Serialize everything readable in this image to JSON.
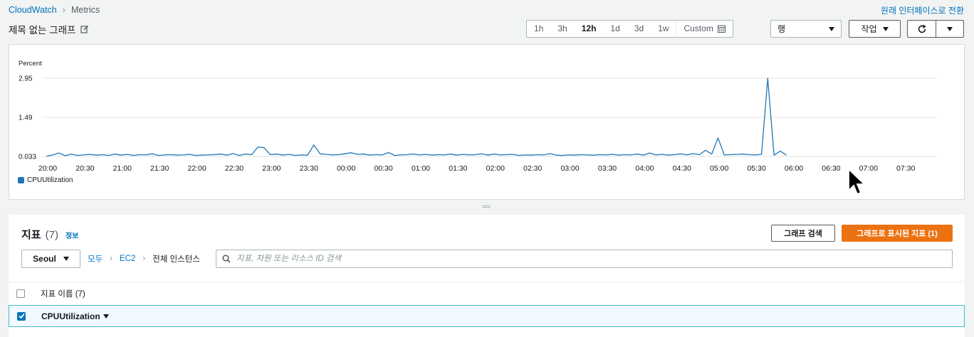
{
  "breadcrumb": {
    "root": "CloudWatch",
    "current": "Metrics"
  },
  "switch_link": "원래 인터페이스로 전환",
  "graph_title": "제목 없는 그래프",
  "time_ranges": [
    "1h",
    "3h",
    "12h",
    "1d",
    "3d",
    "1w"
  ],
  "time_range_selected": "12h",
  "custom_label": "Custom",
  "view_select": {
    "value": "행"
  },
  "actions_label": "작업",
  "chart_data": {
    "type": "line",
    "ylabel": "Percent",
    "y_ticks": [
      "0.033",
      "1.49",
      "2.95"
    ],
    "ylim": [
      0.033,
      2.95
    ],
    "x_ticks": [
      "20:00",
      "20:30",
      "21:00",
      "21:30",
      "22:00",
      "22:30",
      "23:00",
      "23:30",
      "00:00",
      "00:30",
      "01:00",
      "01:30",
      "02:00",
      "02:30",
      "03:00",
      "03:30",
      "04:00",
      "04:30",
      "05:00",
      "05:30",
      "06:00",
      "06:30",
      "07:00",
      "07:30"
    ],
    "x_start": "19:59",
    "x_step_minutes": 5,
    "series": [
      {
        "name": "CPUUtilization",
        "color": "#1f77b4",
        "values": [
          0.04,
          0.09,
          0.16,
          0.06,
          0.12,
          0.07,
          0.09,
          0.11,
          0.08,
          0.1,
          0.07,
          0.12,
          0.08,
          0.11,
          0.07,
          0.1,
          0.09,
          0.13,
          0.07,
          0.09,
          0.1,
          0.08,
          0.09,
          0.11,
          0.07,
          0.08,
          0.09,
          0.1,
          0.12,
          0.08,
          0.14,
          0.07,
          0.12,
          0.1,
          0.38,
          0.36,
          0.1,
          0.12,
          0.08,
          0.11,
          0.07,
          0.09,
          0.08,
          0.46,
          0.13,
          0.11,
          0.09,
          0.1,
          0.13,
          0.17,
          0.11,
          0.12,
          0.08,
          0.1,
          0.09,
          0.18,
          0.07,
          0.09,
          0.1,
          0.12,
          0.09,
          0.11,
          0.08,
          0.1,
          0.09,
          0.12,
          0.08,
          0.11,
          0.09,
          0.1,
          0.13,
          0.08,
          0.12,
          0.09,
          0.1,
          0.11,
          0.07,
          0.09,
          0.08,
          0.1,
          0.09,
          0.14,
          0.08,
          0.07,
          0.09,
          0.08,
          0.1,
          0.09,
          0.08,
          0.1,
          0.09,
          0.11,
          0.08,
          0.1,
          0.09,
          0.12,
          0.08,
          0.16,
          0.09,
          0.11,
          0.08,
          0.1,
          0.13,
          0.09,
          0.14,
          0.1,
          0.26,
          0.12,
          0.72,
          0.09,
          0.1,
          0.11,
          0.12,
          0.1,
          0.09,
          0.11,
          2.95,
          0.08,
          0.23,
          0.08
        ]
      }
    ],
    "legend": [
      "CPUUtilization"
    ],
    "legend_position": "bottom-left"
  },
  "metrics": {
    "title": "지표",
    "count": "(7)",
    "info": "정보",
    "search_graph_button": "그래프 검색",
    "graphed_button": "그래프로 표시된 지표 (1)",
    "region": "Seoul",
    "crumbs": [
      "모두",
      "EC2"
    ],
    "crumb_current": "전체 인스턴스",
    "search_placeholder": "지표, 차원 또는 리소스 ID 검색",
    "column_header": "지표 이름 (7)",
    "rows": [
      {
        "label": "CPUUtilization",
        "checked": true
      }
    ]
  }
}
